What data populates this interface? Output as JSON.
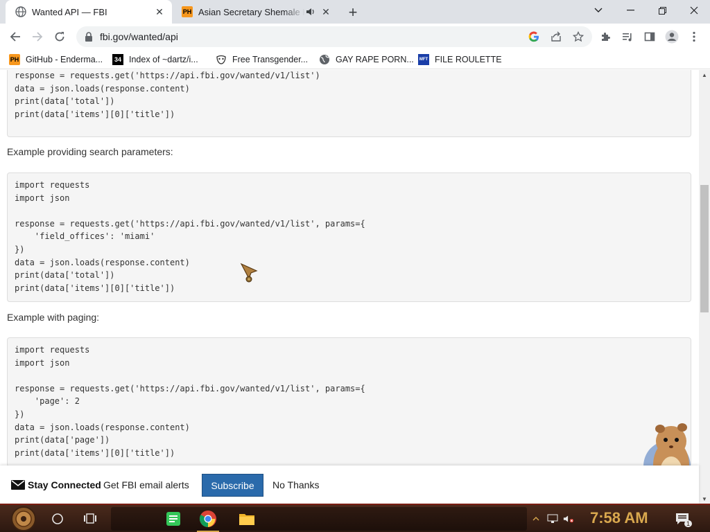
{
  "tabs": [
    {
      "title": "Wanted API — FBI",
      "icon": "globe-icon",
      "active": true
    },
    {
      "title": "Asian Secretary Shemale Hentai",
      "favicon_text": "PH",
      "icon": "pornhub-favicon-icon",
      "active": false
    }
  ],
  "toolbar": {
    "url": "fbi.gov/wanted/api"
  },
  "bookmarks": [
    {
      "label": "GitHub - Enderma...",
      "favicon_text": "PH"
    },
    {
      "label": "Index of ~dartz/i...",
      "favicon_text": "34"
    },
    {
      "label": "Free Transgender...",
      "icon": "mask-icon"
    },
    {
      "label": "GAY RAPE PORN...",
      "icon": "globe-icon"
    },
    {
      "label": "FILE ROULETTE",
      "favicon_text": "MFT"
    }
  ],
  "content": {
    "code_block_1": "response = requests.get('https://api.fbi.gov/wanted/v1/list')\ndata = json.loads(response.content)\nprint(data['total'])\nprint(data['items'][0]['title'])",
    "para_1": "Example providing search parameters:",
    "code_block_2": "import requests\nimport json\n\nresponse = requests.get('https://api.fbi.gov/wanted/v1/list', params={\n    'field_offices': 'miami'\n})\ndata = json.loads(response.content)\nprint(data['total'])\nprint(data['items'][0]['title'])",
    "para_2": "Example with paging:",
    "code_block_3": "import requests\nimport json\n\nresponse = requests.get('https://api.fbi.gov/wanted/v1/list', params={\n    'page': 2\n})\ndata = json.loads(response.content)\nprint(data['page'])\nprint(data['items'][0]['title'])"
  },
  "banner": {
    "title": "Stay Connected",
    "text": "Get FBI email alerts",
    "subscribe": "Subscribe",
    "no_thanks": "No Thanks"
  },
  "taskbar": {
    "clock": "7:58 AM",
    "notification_count": "1"
  },
  "colors": {
    "subscribe_bg": "#2a6aab",
    "clock": "#d9a84e",
    "taskbar": "#2c1810"
  }
}
